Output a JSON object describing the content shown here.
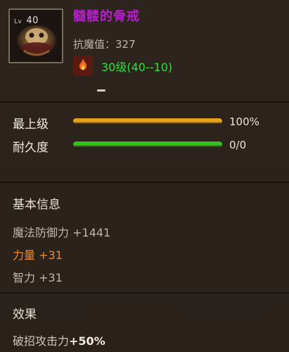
{
  "item": {
    "level_prefix": "Lv",
    "level": "40",
    "name": "髓髅的骨戒",
    "resist_label": "抗魔值：",
    "resist_value": "327",
    "requirement": "30级(40--10)"
  },
  "bars": [
    {
      "label": "最上级",
      "value": "100%",
      "fill": 1.0,
      "color": "#e6a21f"
    },
    {
      "label": "耐久度",
      "value": "0/0",
      "fill": 1.0,
      "color": "#34c21c"
    }
  ],
  "basic": {
    "title": "基本信息",
    "lines": [
      {
        "label": "魔法防御力",
        "bonus": "+1441"
      },
      {
        "label": "力量",
        "bonus": "+31"
      },
      {
        "label": "智力",
        "bonus": "+31"
      }
    ]
  },
  "effects": {
    "title": "效果",
    "line_label": "破招攻击力",
    "line_bonus": "+50%"
  }
}
